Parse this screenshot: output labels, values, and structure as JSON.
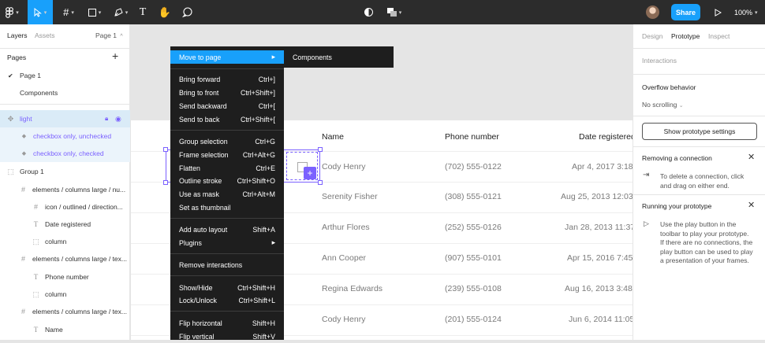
{
  "toolbar": {
    "share_label": "Share",
    "zoom_label": "100%"
  },
  "left_panel": {
    "tabs": [
      "Layers",
      "Assets"
    ],
    "page_selector": "Page 1",
    "pages_label": "Pages",
    "pages": [
      "Page 1",
      "Components"
    ],
    "layers": [
      "light",
      "checkbox only, unchecked",
      "checkbox only, checked",
      "Group 1",
      "elements / columns large / nu...",
      "icon / outlined / direction...",
      "Date registered",
      "column",
      "elements / columns large / tex...",
      "Phone number",
      "column",
      "elements / columns large / tex...",
      "Name"
    ]
  },
  "table": {
    "headers": [
      "Name",
      "Phone number",
      "Date registered"
    ],
    "rows": [
      [
        "Cody Henry",
        "(702) 555-0122",
        "Apr 4, 2017 3:18"
      ],
      [
        "Serenity Fisher",
        "(308) 555-0121",
        "Aug 25, 2013 12:03"
      ],
      [
        "Arthur Flores",
        "(252) 555-0126",
        "Jan 28, 2013 11:37"
      ],
      [
        "Ann Cooper",
        "(907) 555-0101",
        "Apr 15, 2016 7:45"
      ],
      [
        "Regina Edwards",
        "(239) 555-0108",
        "Aug 16, 2013 3:48"
      ],
      [
        "Cody Henry",
        "(201) 555-0124",
        "Jun 6, 2014 11:05"
      ]
    ]
  },
  "context_menu": {
    "items": [
      {
        "label": "Move to page",
        "shortcut": "▸"
      },
      {
        "label": "Bring forward",
        "shortcut": "Ctrl+]"
      },
      {
        "label": "Bring to front",
        "shortcut": "Ctrl+Shift+]"
      },
      {
        "label": "Send backward",
        "shortcut": "Ctrl+["
      },
      {
        "label": "Send to back",
        "shortcut": "Ctrl+Shift+["
      },
      {
        "label": "Group selection",
        "shortcut": "Ctrl+G"
      },
      {
        "label": "Frame selection",
        "shortcut": "Ctrl+Alt+G"
      },
      {
        "label": "Flatten",
        "shortcut": "Ctrl+E"
      },
      {
        "label": "Outline stroke",
        "shortcut": "Ctrl+Shift+O"
      },
      {
        "label": "Use as mask",
        "shortcut": "Ctrl+Alt+M"
      },
      {
        "label": "Set as thumbnail",
        "shortcut": ""
      },
      {
        "label": "Add auto layout",
        "shortcut": "Shift+A"
      },
      {
        "label": "Plugins",
        "shortcut": "▸"
      },
      {
        "label": "Remove interactions",
        "shortcut": ""
      },
      {
        "label": "Show/Hide",
        "shortcut": "Ctrl+Shift+H"
      },
      {
        "label": "Lock/Unlock",
        "shortcut": "Ctrl+Shift+L"
      },
      {
        "label": "Flip horizontal",
        "shortcut": "Shift+H"
      },
      {
        "label": "Flip vertical",
        "shortcut": "Shift+V"
      }
    ],
    "submenu_item": "Components"
  },
  "right_panel": {
    "tabs": [
      "Design",
      "Prototype",
      "Inspect"
    ],
    "interactions_label": "Interactions",
    "overflow_label": "Overflow behavior",
    "overflow_value": "No scrolling",
    "settings_button": "Show prototype settings",
    "removing_title": "Removing a connection",
    "removing_text": [
      "To delete a connection, click",
      "and drag on either end."
    ],
    "running_title": "Running your prototype",
    "running_text": [
      "Use the play button in the",
      "toolbar to play your prototype.",
      "If there are no connections, the",
      "play button can be used to play",
      "a presentation of your frames."
    ]
  },
  "colors": {
    "accent": "#18a0fb",
    "selection": "#7b61ff",
    "menu_bg": "#1e1e1e"
  }
}
